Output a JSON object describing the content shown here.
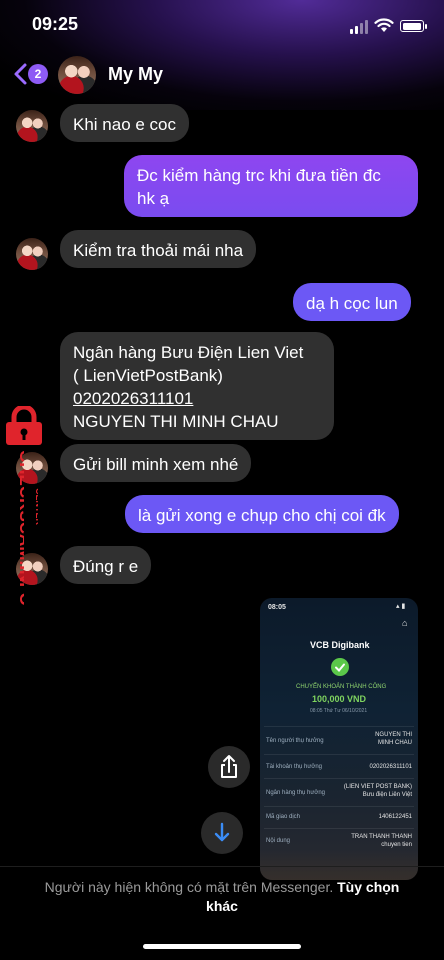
{
  "status": {
    "time": "09:25"
  },
  "header": {
    "back_badge": "2",
    "title": "My My"
  },
  "messages": [
    {
      "side": "received",
      "text": "Khi nao e coc"
    },
    {
      "side": "sent",
      "line1": "Đc kiểm hàng trc khi đưa tiền đc",
      "line2": "hk ạ"
    },
    {
      "side": "received",
      "text": "Kiểm tra thoải mái nha"
    },
    {
      "side": "sent",
      "text": "dạ h cọc lun"
    },
    {
      "side": "received",
      "line1": "Ngân hàng Bưu Điện Lien Viet",
      "line2": "( LienVietPostBank)",
      "line3": "0202026311101",
      "line4": "NGUYEN THI MINH CHAU"
    },
    {
      "side": "received",
      "text": "Gửi bill minh xem nhé"
    },
    {
      "side": "sent",
      "text": "là gửi xong e chụp cho chị coi đk"
    },
    {
      "side": "received",
      "text": "Đúng r e"
    }
  ],
  "shared_screenshot": {
    "time": "08:05",
    "bank": "VCB Digibank",
    "status": "CHUYỂN KHOẢN THÀNH CÔNG",
    "amount": "100,000 VND",
    "datetime": "08:05 Thứ Tư 06/10/2021",
    "rows": [
      {
        "label": "Tên người thụ hưởng",
        "value1": "NGUYEN THI",
        "value2": "MINH CHAU"
      },
      {
        "label": "Tài khoản thụ hưởng",
        "value1": "0202026311101",
        "value2": ""
      },
      {
        "label": "Ngân hàng thụ hưởng",
        "value1": "(LIEN VIET POST BANK)",
        "value2": "Bưu điện Liên Việt"
      },
      {
        "label": "Mã giao dịch",
        "value1": "1406122451",
        "value2": ""
      },
      {
        "label": "Nội dung",
        "value1": "TRAN THANH THANH",
        "value2": "chuyen tien"
      }
    ]
  },
  "footer": {
    "notice": "Người này hiện không có mặt trên Messenger.",
    "link": "Tùy chọn khác"
  },
  "watermark": {
    "text": "CHECKSCAM.INFO",
    "sub": "CENTER"
  },
  "colors": {
    "sent": "#7a4cf0",
    "received": "#303030",
    "accent": "#8e5bf5",
    "watermark": "#e0242c"
  }
}
